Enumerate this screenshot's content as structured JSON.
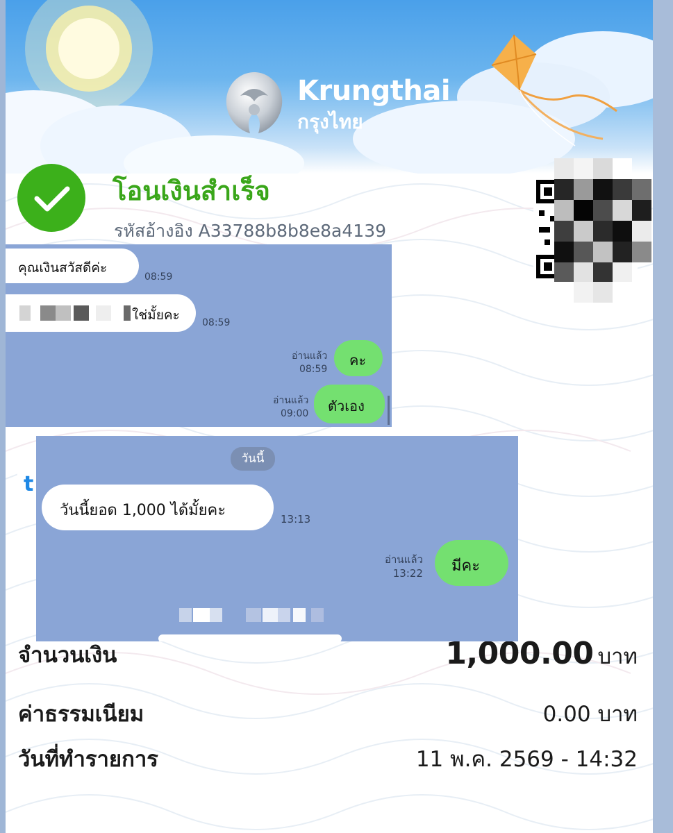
{
  "brand": {
    "name_en": "Krungthai",
    "name_th": "กรุงไทย"
  },
  "status": {
    "title": "โอนเงินสำเร็จ",
    "reference": "รหัสอ้างอิง A33788b8b8e8a4139",
    "icon": "check-icon",
    "color": "#3cb01b"
  },
  "qr": {
    "icon": "qr-code"
  },
  "chat_top": {
    "messages": [
      {
        "side": "in",
        "text": "คุณเงินสวัสดีค่ะ",
        "time": "08:59"
      },
      {
        "side": "in",
        "text": "ใช่มั้ยคะ",
        "time": "08:59",
        "redacted_prefix": true
      },
      {
        "side": "out",
        "text": "คะ",
        "read": "อ่านแล้ว",
        "time": "08:59"
      },
      {
        "side": "out",
        "text": "ตัวเอง",
        "read": "อ่านแล้ว",
        "time": "09:00"
      }
    ]
  },
  "chat_bottom": {
    "date_chip": "วันนี้",
    "messages": [
      {
        "side": "in",
        "text": "วันนี้ยอด 1,000 ได้มั้ยคะ",
        "time": "13:13"
      },
      {
        "side": "out",
        "text": "มีคะ",
        "read": "อ่านแล้ว",
        "time": "13:22"
      }
    ]
  },
  "details": {
    "amount_label": "จำนวนเงิน",
    "amount_value": "1,000.00",
    "amount_unit": "บาท",
    "fee_label": "ค่าธรรมเนียม",
    "fee_value": "0.00 บาท",
    "date_label": "วันที่ทำรายการ",
    "date_value": "11 พ.ค. 2569 - 14:32"
  },
  "colors": {
    "chat_background": "#8aa5d6",
    "incoming_bubble": "#ffffff",
    "outgoing_bubble": "#74e070",
    "sky_top": "#4aa0ea"
  }
}
